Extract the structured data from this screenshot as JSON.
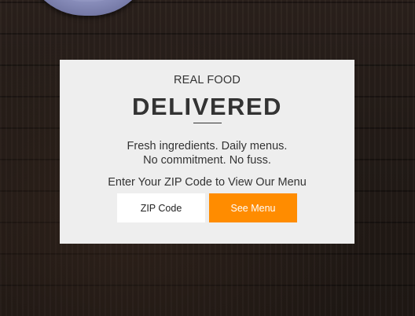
{
  "card": {
    "eyebrow": "REAL FOOD",
    "headline": "DELIVERED",
    "line1": "Fresh ingredients. Daily menus.",
    "line2": "No commitment. No fuss.",
    "zip_prompt": "Enter Your ZIP Code to View Our Menu"
  },
  "form": {
    "zip_placeholder": "ZIP Code",
    "submit_label": "See Menu"
  },
  "colors": {
    "accent": "#ff8c00",
    "card_background": "#eeeeee",
    "text": "#333333"
  }
}
